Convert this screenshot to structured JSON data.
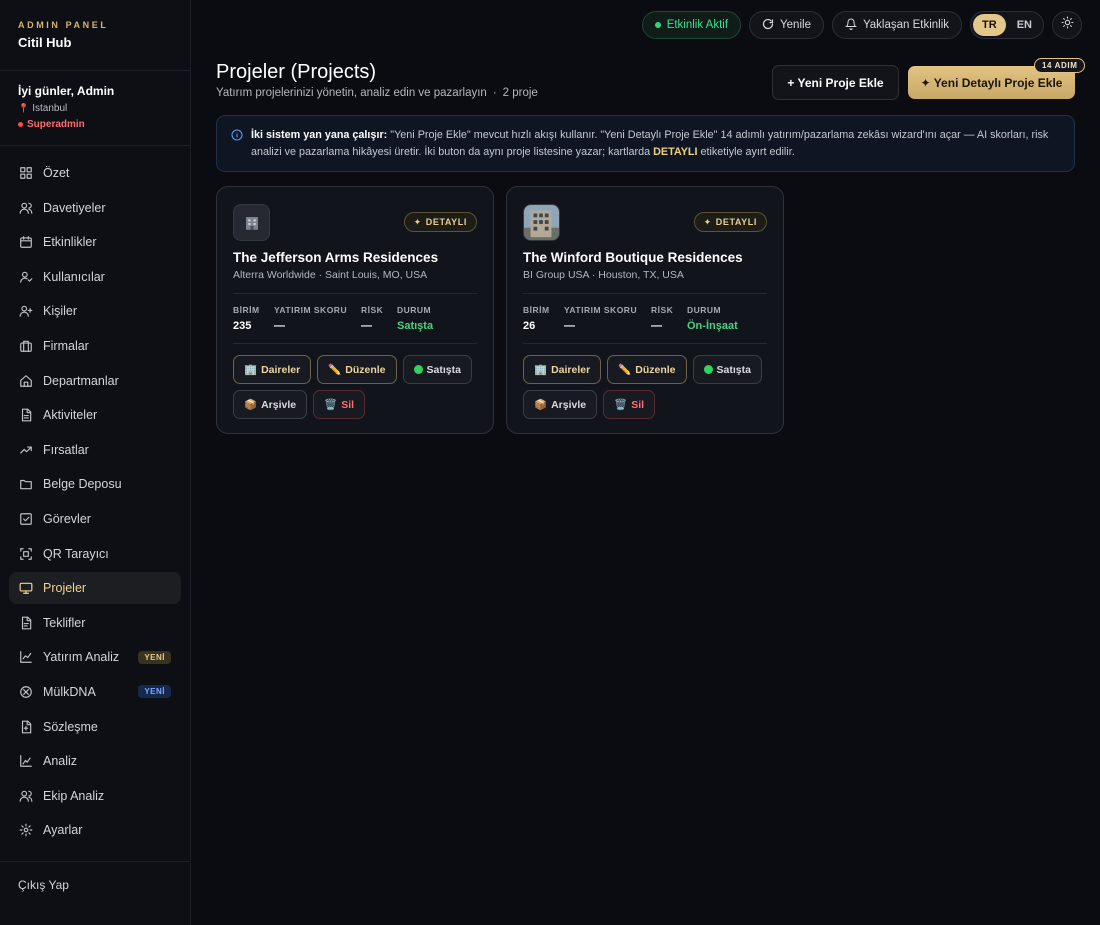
{
  "brand": {
    "kicker": "ADMIN PANEL",
    "name": "Citil Hub"
  },
  "user": {
    "greeting": "İyi günler, Admin",
    "location": "Istanbul",
    "role": "Superadmin"
  },
  "nav": [
    {
      "label": "Özet",
      "icon": "grid-icon"
    },
    {
      "label": "Davetiyeler",
      "icon": "users-icon"
    },
    {
      "label": "Etkinlikler",
      "icon": "calendar-icon"
    },
    {
      "label": "Kullanıcılar",
      "icon": "user-icon"
    },
    {
      "label": "Kişiler",
      "icon": "user-plus-icon"
    },
    {
      "label": "Firmalar",
      "icon": "briefcase-icon"
    },
    {
      "label": "Departmanlar",
      "icon": "home-icon"
    },
    {
      "label": "Aktiviteler",
      "icon": "file-icon"
    },
    {
      "label": "Fırsatlar",
      "icon": "trend-icon"
    },
    {
      "label": "Belge Deposu",
      "icon": "folder-icon"
    },
    {
      "label": "Görevler",
      "icon": "check-icon"
    },
    {
      "label": "QR Tarayıcı",
      "icon": "qr-icon"
    },
    {
      "label": "Projeler",
      "icon": "monitor-icon",
      "active": true
    },
    {
      "label": "Teklifler",
      "icon": "document-icon"
    },
    {
      "label": "Yatırım Analiz",
      "icon": "chart-icon",
      "badge": "YENİ"
    },
    {
      "label": "MülkDNA",
      "icon": "dna-icon",
      "badge": "YENİ"
    },
    {
      "label": "Sözleşme",
      "icon": "contract-icon"
    },
    {
      "label": "Analiz",
      "icon": "analytics-icon"
    },
    {
      "label": "Ekip Analiz",
      "icon": "team-icon"
    },
    {
      "label": "Ayarlar",
      "icon": "gear-icon"
    }
  ],
  "logout": "Çıkış Yap",
  "topbar": {
    "status": "Etkinlik Aktif",
    "refresh": "Yenile",
    "upcoming": "Yaklaşan Etkinlik",
    "lang_tr": "TR",
    "lang_en": "EN"
  },
  "header": {
    "title": "Projeler (Projects)",
    "subtitle": "Yatırım projelerinizi yönetin, analiz edin ve pazarlayın",
    "separator": "·",
    "count": "2 proje",
    "new_button": "+ Yeni Proje Ekle",
    "detail_button": "✦ Yeni Detaylı Proje Ekle",
    "step_badge": "14 ADIM"
  },
  "info": {
    "lead": "İki sistem yan yana çalışır:",
    "text1": " \"Yeni Proje Ekle\" mevcut hızlı akışı kullanır. \"Yeni Detaylı Proje Ekle\" 14 adımlı yatırım/pazarlama zekâsı wizard'ını açar — AI skorları, risk analizi ve pazarlama hikâyesi üretir. İki buton da aynı proje listesine yazar; kartlarda ",
    "highlight": "DETAYLI",
    "text2": " etiketiyle ayırt edilir."
  },
  "labels": {
    "badge": "DETAYLI",
    "units": "BİRİM",
    "score": "YATIRIM SKORU",
    "risk": "RİSK",
    "status": "DURUM",
    "apartments": "Daireler",
    "edit": "Düzenle",
    "archive": "Arşivle",
    "delete": "Sil"
  },
  "projects": [
    {
      "title": "The Jefferson Arms Residences",
      "subtitle": "Alterra Worldwide · Saint Louis, MO, USA",
      "units": "235",
      "score": "—",
      "risk": "—",
      "status": "Satışta",
      "sale_status": "Satışta"
    },
    {
      "title": "The Winford Boutique Residences",
      "subtitle": "BI Group USA · Houston, TX, USA",
      "units": "26",
      "score": "—",
      "risk": "—",
      "status": "Ön-İnşaat",
      "sale_status": "Satışta"
    }
  ]
}
